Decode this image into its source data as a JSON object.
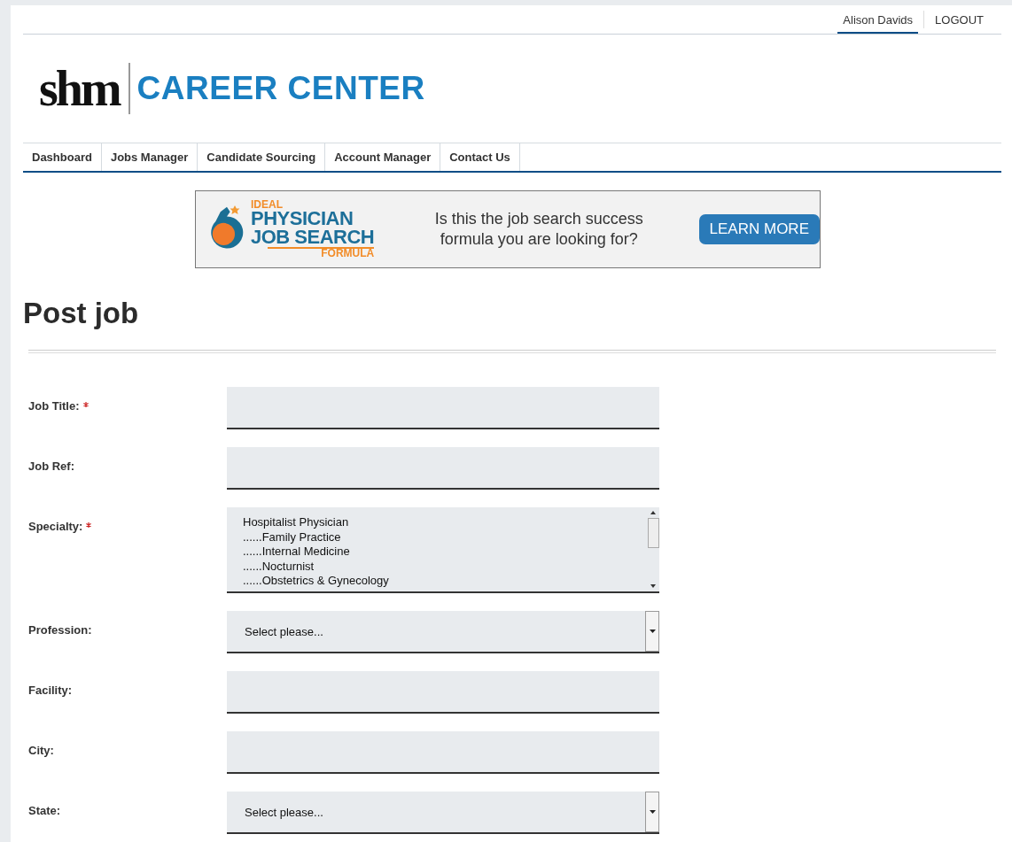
{
  "user_menu": [
    {
      "label": "Alison Davids",
      "selected": true
    },
    {
      "label": "LOGOUT",
      "selected": false
    }
  ],
  "logo": {
    "mark": "shm",
    "title": "CAREER CENTER"
  },
  "nav": [
    {
      "label": "Dashboard"
    },
    {
      "label": "Jobs Manager"
    },
    {
      "label": "Candidate Sourcing"
    },
    {
      "label": "Account Manager"
    },
    {
      "label": "Contact Us"
    }
  ],
  "banner": {
    "logo_lines": [
      "IDEAL",
      "PHYSICIAN",
      "JOB SEARCH",
      "FORMULA"
    ],
    "message": "Is this the job search success formula you are looking for?",
    "button": "LEARN MORE"
  },
  "heading": "Post job",
  "fields": [
    {
      "label": "Job Title:",
      "required": true,
      "kind": "text"
    },
    {
      "label": "Job Ref:",
      "required": false,
      "kind": "text"
    },
    {
      "label": "Specialty:",
      "required": true,
      "kind": "list",
      "options": [
        "Hospitalist Physician",
        "......Family Practice",
        "......Internal Medicine",
        "......Nocturnist",
        "......Obstetrics & Gynecology"
      ]
    },
    {
      "label": "Profession:",
      "required": false,
      "kind": "select",
      "value": "Select please..."
    },
    {
      "label": "Facility:",
      "required": false,
      "kind": "text"
    },
    {
      "label": "City:",
      "required": false,
      "kind": "text"
    },
    {
      "label": "State:",
      "required": false,
      "kind": "select",
      "value": "Select please..."
    }
  ]
}
